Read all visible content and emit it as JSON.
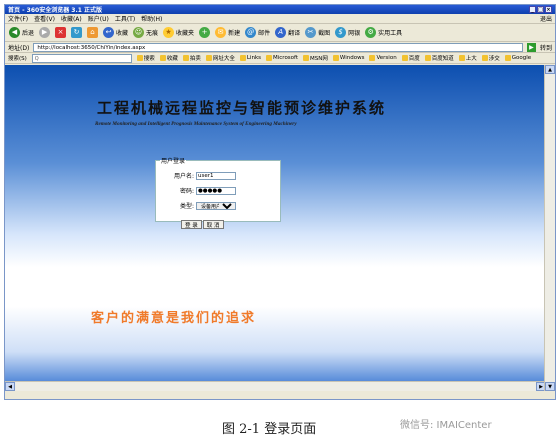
{
  "browser": {
    "title": "首页 - 360安全浏览器 3.1 正式版",
    "menu": [
      "文件(F)",
      "查看(V)",
      "收藏(A)",
      "账户(U)",
      "工具(T)",
      "帮助(H)"
    ],
    "menu_right": "退出",
    "toolbar": [
      "后退",
      "前进",
      "停止",
      "刷新",
      "主页",
      "收藏",
      "无痕",
      "收藏夹",
      "新建",
      "邮件",
      "翻译",
      "截图",
      "网银",
      "实用工具"
    ],
    "address_label": "地址(D)",
    "address_value": "http://localhost:3650/ChiYin/index.aspx",
    "go_label": "转到",
    "search_label": "搜索(S)",
    "favorites": [
      "搜索",
      "收藏",
      "拍卖",
      "网址大全",
      "Links",
      "Microsoft",
      "MSN网",
      "Windows",
      "Version",
      "百度",
      "百度知道",
      "上大",
      "涉交",
      "Google"
    ]
  },
  "page": {
    "title": "工程机械远程监控与智能预诊维护系统",
    "subtitle": "Remote Monitoring and Intelligent Prognosis Maintenance System of Engineering Machinery",
    "login": {
      "legend": "用户登录",
      "username_label": "用户名:",
      "username_value": "user1",
      "password_label": "密码:",
      "password_value": "●●●●●",
      "type_label": "类型:",
      "type_value": "设备用户",
      "login_button": "登 录",
      "cancel_button": "取 消"
    },
    "slogan": "客户的满意是我们的追求"
  },
  "caption": "图 2-1  登录页面",
  "watermark": "微信号: IMAICenter"
}
